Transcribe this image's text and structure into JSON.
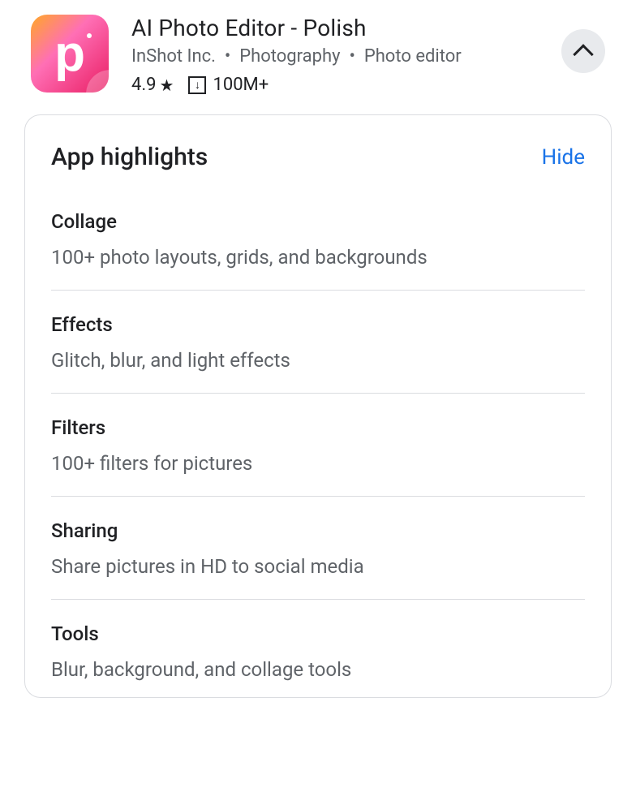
{
  "app": {
    "title": "AI Photo Editor - Polish",
    "developer": "InShot Inc.",
    "category": "Photography",
    "subcategory": "Photo editor",
    "rating": "4.9",
    "downloads": "100M+",
    "icon_letter": "p"
  },
  "highlights": {
    "section_title": "App highlights",
    "hide_label": "Hide",
    "items": [
      {
        "name": "Collage",
        "desc": "100+ photo layouts, grids, and backgrounds"
      },
      {
        "name": "Effects",
        "desc": "Glitch, blur, and light effects"
      },
      {
        "name": "Filters",
        "desc": "100+ filters for pictures"
      },
      {
        "name": "Sharing",
        "desc": "Share pictures in HD to social media"
      },
      {
        "name": "Tools",
        "desc": "Blur, background, and collage tools"
      }
    ]
  }
}
